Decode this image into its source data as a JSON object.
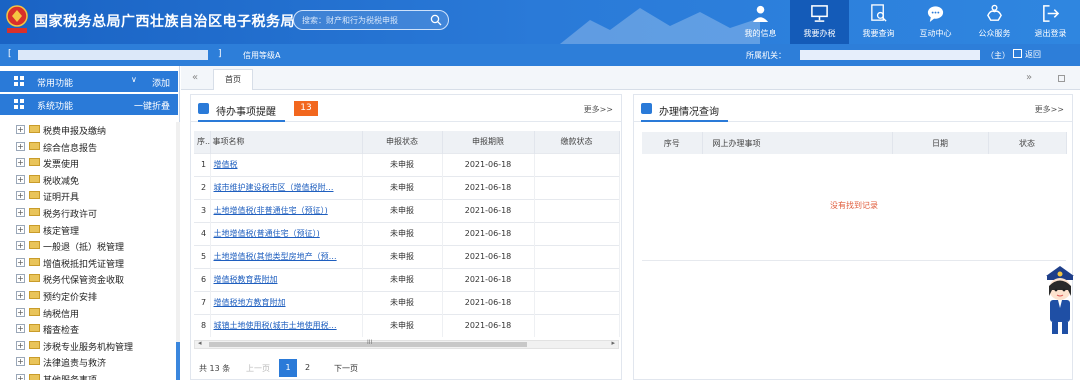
{
  "header": {
    "title": "国家税务总局广西壮族自治区电子税务局",
    "search_placeholder": "搜索：财产和行为税税申报",
    "nav": [
      {
        "label": "我的信息",
        "icon": "user-icon"
      },
      {
        "label": "我要办税",
        "icon": "monitor-icon"
      },
      {
        "label": "我要查询",
        "icon": "document-search-icon"
      },
      {
        "label": "互动中心",
        "icon": "chat-icon"
      },
      {
        "label": "公众服务",
        "icon": "hand-icon"
      },
      {
        "label": "退出登录",
        "icon": "logout-icon"
      }
    ]
  },
  "subbar": {
    "bracket_left": "[",
    "bracket_right": "]",
    "credit_label": "信用等级A",
    "org_label": "所属机关：",
    "main_tag": "（主）",
    "back_label": "返回"
  },
  "sidebar": {
    "common": {
      "title": "常用功能",
      "caret": "∨",
      "action": "添加"
    },
    "system": {
      "title": "系统功能",
      "action": "一键折叠"
    },
    "tree": [
      "税费申报及缴纳",
      "综合信息报告",
      "发票使用",
      "税收减免",
      "证明开具",
      "税务行政许可",
      "核定管理",
      "一般退（抵）税管理",
      "增值税抵扣凭证管理",
      "税务代保管资金收取",
      "预约定价安排",
      "纳税信用",
      "稽查检查",
      "涉税专业服务机构管理",
      "法律追责与救济",
      "其他服务事项"
    ]
  },
  "tabs": {
    "home": "首页",
    "left_arrows": "«",
    "right_arrows": "»"
  },
  "todo": {
    "title": "待办事项提醒",
    "count": "13",
    "more": "更多>>",
    "columns": [
      "序..",
      "事项名称",
      "申报状态",
      "申报期限",
      "缴款状态"
    ],
    "rows": [
      {
        "seq": "1",
        "name": "增值税",
        "status": "未申报",
        "deadline": "2021-06-18",
        "pay": ""
      },
      {
        "seq": "2",
        "name": "城市维护建设税市区（增值税附…",
        "status": "未申报",
        "deadline": "2021-06-18",
        "pay": ""
      },
      {
        "seq": "3",
        "name": "土地增值税(非普通住宅（预征）)",
        "status": "未申报",
        "deadline": "2021-06-18",
        "pay": ""
      },
      {
        "seq": "4",
        "name": "土地增值税(普通住宅（预征）)",
        "status": "未申报",
        "deadline": "2021-06-18",
        "pay": ""
      },
      {
        "seq": "5",
        "name": "土地增值税(其他类型房地产（预…",
        "status": "未申报",
        "deadline": "2021-06-18",
        "pay": ""
      },
      {
        "seq": "6",
        "name": "增值税教育费附加",
        "status": "未申报",
        "deadline": "2021-06-18",
        "pay": ""
      },
      {
        "seq": "7",
        "name": "增值税地方教育附加",
        "status": "未申报",
        "deadline": "2021-06-18",
        "pay": ""
      },
      {
        "seq": "8",
        "name": "城镇土地使用税(城市土地使用税…",
        "status": "未申报",
        "deadline": "2021-06-18",
        "pay": ""
      }
    ],
    "pager": {
      "total": "共 13 条",
      "prev": "上一页",
      "page1": "1",
      "page2": "2",
      "next": "下一页"
    },
    "scroll_grip": "III"
  },
  "query": {
    "title": "办理情况查询",
    "more": "更多>>",
    "columns": [
      "序号",
      "网上办理事项",
      "日期",
      "状态"
    ],
    "empty": "没有找到记录"
  },
  "colors": {
    "primary": "#2a7ad8",
    "header": "#1a63c4",
    "badge": "#f2671e",
    "link": "#1f5fbf",
    "empty": "#e05b3a"
  }
}
